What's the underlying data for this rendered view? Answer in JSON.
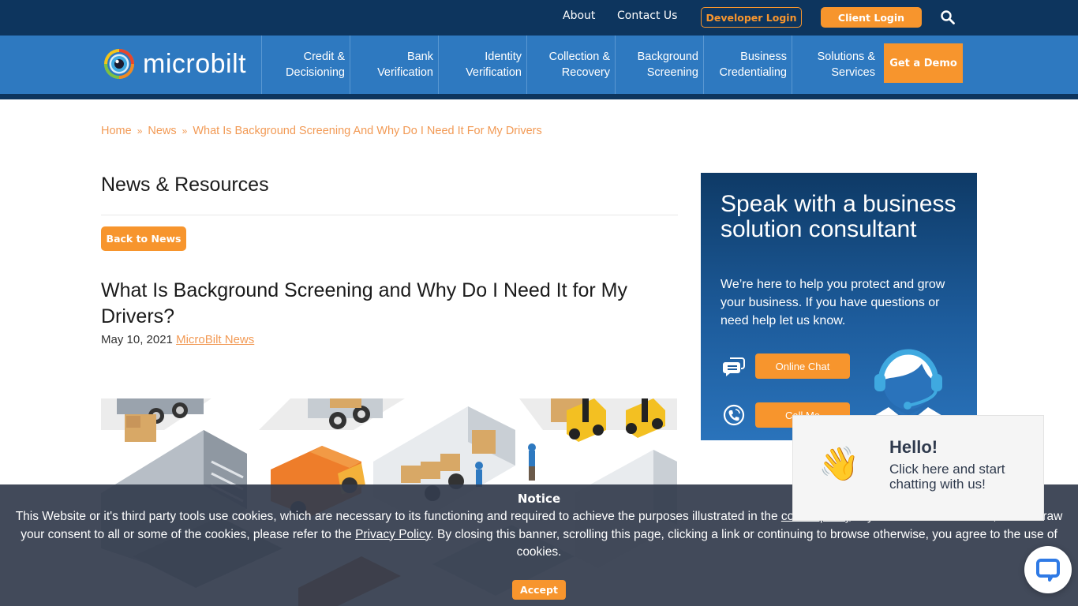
{
  "topbar": {
    "about": "About",
    "contact": "Contact Us",
    "developer_login": "Developer Login",
    "client_login": "Client Login",
    "search_icon": "search-icon"
  },
  "brand": {
    "name": "microbilt",
    "logo_icon": "eye-logo-icon",
    "colors": {
      "topbar": "#0d355e",
      "nav": "#2e79c0",
      "accent": "#f7952d",
      "link": "#f29a55",
      "cookie_bg": "#343c4e"
    }
  },
  "nav": {
    "items": [
      {
        "line1": "Credit &",
        "line2": "Decisioning"
      },
      {
        "line1": "Bank",
        "line2": "Verification"
      },
      {
        "line1": "Identity",
        "line2": "Verification"
      },
      {
        "line1": "Collection &",
        "line2": "Recovery"
      },
      {
        "line1": "Background",
        "line2": "Screening"
      },
      {
        "line1": "Business",
        "line2": "Credentialing"
      },
      {
        "line1": "Solutions &",
        "line2": "Services"
      }
    ],
    "demo": "Get a Demo"
  },
  "breadcrumb": {
    "home": "Home",
    "news": "News",
    "current": "What Is Background Screening And Why Do I Need It For My Drivers",
    "separator": "»"
  },
  "content": {
    "section_title": "News & Resources",
    "back_button": "Back to News",
    "article_title": "What Is Background Screening and Why Do I Need It for My Drivers?",
    "date": "May 10, 2021",
    "category": "MicroBilt News",
    "hero_alt": "Isometric illustration of trucks, delivery van, forklifts and workers loading boxes"
  },
  "sidebar_cta": {
    "heading": "Speak with a business solution consultant",
    "body": "We’re here to help you protect and grow your business. If you have questions or need help let us know.",
    "chat_button": "Online Chat",
    "call_button": "Call Me",
    "chat_icon": "chat-bubbles-icon",
    "phone_icon": "phone-icon",
    "agent_icon": "support-agent-icon"
  },
  "cookie_banner": {
    "title": "Notice",
    "text_before": "This Website or it's third party tools use cookies, which are necessary to its functioning and required to achieve the purposes illustrated in the ",
    "cookie_policy_link": "cookie policy",
    "text_middle": ". If you want to know more, or withdraw your consent to all or some of the cookies, please refer to the ",
    "privacy_link": "Privacy Policy",
    "text_after": ". By closing this banner, scrolling this page, clicking a link or continuing to browse otherwise, you agree to the use of cookies.",
    "accept": "Accept"
  },
  "chat_popup": {
    "emoji": "👋",
    "title": "Hello!",
    "message": "Click here and start chatting with us!",
    "launcher_icon": "chat-launcher-icon"
  }
}
